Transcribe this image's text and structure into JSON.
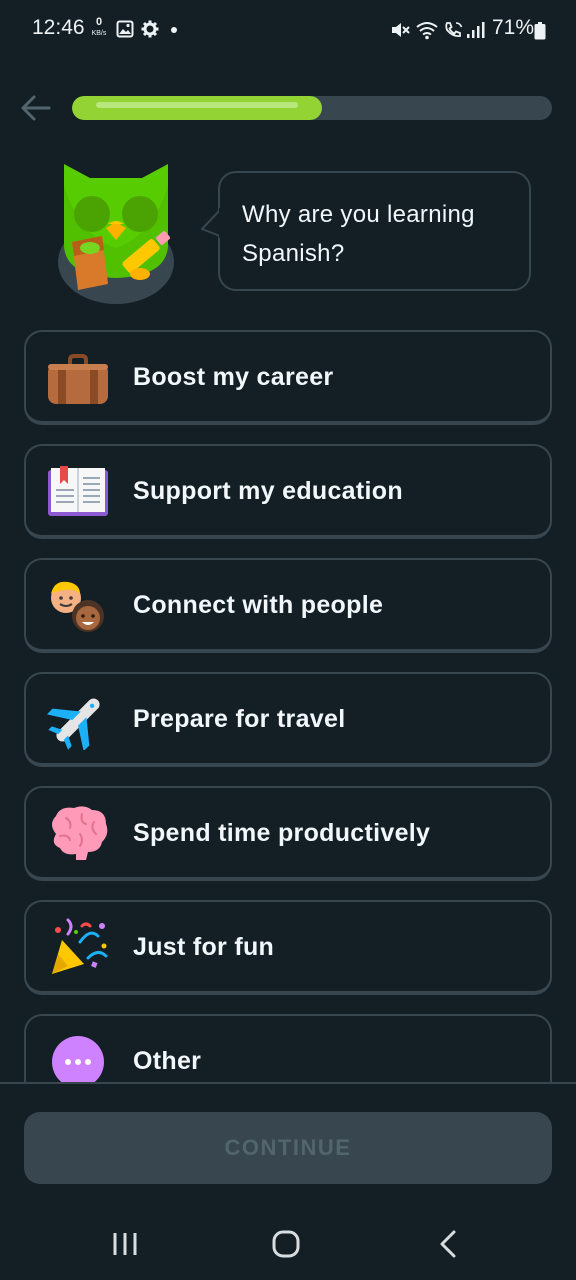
{
  "status_bar": {
    "time": "12:46",
    "net_speed_value": "0",
    "net_speed_unit": "KB/s",
    "battery": "71%",
    "icons": [
      "gallery-icon",
      "settings-icon",
      "dot-icon",
      "mute-icon",
      "wifi-icon",
      "wifi-call-icon",
      "signal-icon",
      "battery-icon"
    ]
  },
  "header": {
    "back_icon": "arrow-left-icon",
    "progress_fraction": 0.52
  },
  "prompt": {
    "question": "Why are you learning Spanish?"
  },
  "options": [
    {
      "label": "Boost my career",
      "icon": "briefcase-icon"
    },
    {
      "label": "Support my education",
      "icon": "book-icon"
    },
    {
      "label": "Connect with people",
      "icon": "people-icon"
    },
    {
      "label": "Prepare for travel",
      "icon": "airplane-icon"
    },
    {
      "label": "Spend time productively",
      "icon": "brain-icon"
    },
    {
      "label": "Just for fun",
      "icon": "party-popper-icon"
    },
    {
      "label": "Other",
      "icon": "more-icon"
    }
  ],
  "continue_label": "CONTINUE",
  "nav_bar": {
    "icons": [
      "recent-apps-icon",
      "home-icon",
      "back-icon"
    ]
  },
  "colors": {
    "background": "#131f24",
    "border": "#37464f",
    "progress": "#93d333",
    "disabled_text": "#52656d"
  }
}
